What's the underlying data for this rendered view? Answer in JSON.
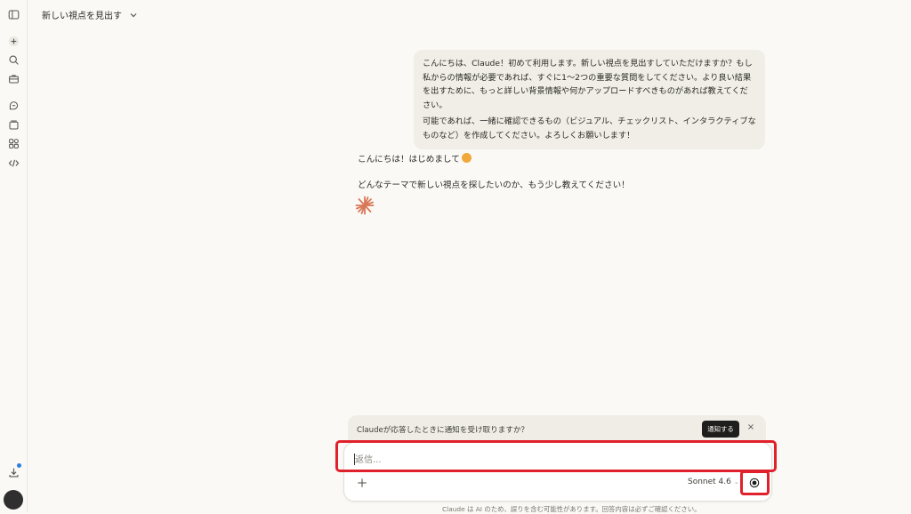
{
  "header": {
    "title": "新しい視点を見出す"
  },
  "sidebar": {
    "icons": [
      "sidebar-toggle-icon",
      "new-chat-icon",
      "search-icon",
      "toolbox-icon",
      "chats-icon",
      "projects-icon",
      "artifacts-icon",
      "code-icon",
      "download-icon"
    ]
  },
  "conversation": {
    "user_message": {
      "paragraph1": "こんにちは、Claude！初めて利用します。新しい視点を見出すしていただけますか？もし私からの情報が必要であれば、すぐに1〜2つの重要な質問をしてください。より良い結果を出すために、もっと詳しい背景情報や何かアップロードすべきものがあれば教えてください。",
      "paragraph2": "可能であれば、一緒に確認できるもの（ビジュアル、チェックリスト、インタラクティブなものなど）を作成してください。よろしくお願いします！"
    },
    "assistant_reply": {
      "line1": "こんにちは！はじめまして",
      "line2": "どんなテーマで新しい視点を探したいのか、もう少し教えてください！"
    }
  },
  "notification_banner": {
    "text": "Claudeが応答したときに通知を受け取りますか？",
    "button_label": "通知する",
    "close_label": "×"
  },
  "composer": {
    "placeholder": "返信...",
    "value": "",
    "model": "Sonnet 4.6"
  },
  "footer": {
    "disclaimer": "Claude は AI のため、誤りを含む可能性があります。回答内容は必ずご確認ください。"
  },
  "colors": {
    "background": "#faf9f5",
    "user_bubble": "#f0eee6",
    "accent_spark": "#d97757",
    "highlight": "#e0202a"
  }
}
